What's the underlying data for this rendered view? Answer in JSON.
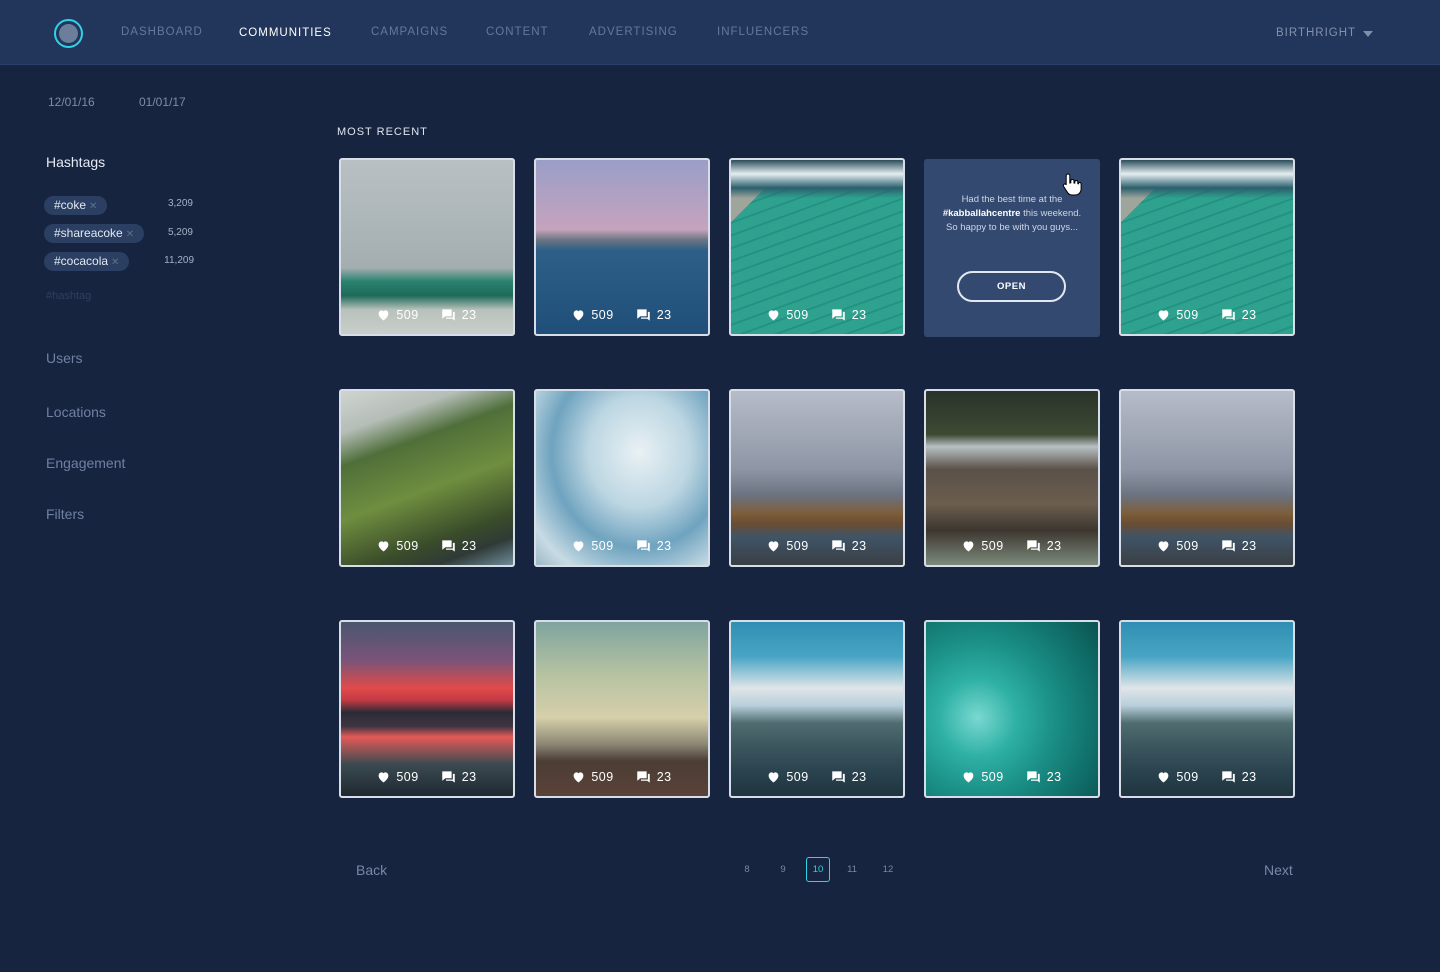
{
  "nav": {
    "items": [
      {
        "label": "DASHBOARD",
        "active": false
      },
      {
        "label": "COMMUNITIES",
        "active": true
      },
      {
        "label": "CAMPAIGNS",
        "active": false
      },
      {
        "label": "CONTENT",
        "active": false
      },
      {
        "label": "ADVERTISING",
        "active": false
      },
      {
        "label": "INFLUENCERS",
        "active": false
      }
    ],
    "account": "BIRTHRIGHT"
  },
  "sidebar": {
    "date_start": "12/01/16",
    "date_end": "01/01/17",
    "hashtags_title": "Hashtags",
    "hashtags": [
      {
        "tag": "#coke",
        "count": "3,209"
      },
      {
        "tag": "#shareacoke",
        "count": "5,209"
      },
      {
        "tag": "#cocacola",
        "count": "11,209"
      }
    ],
    "hashtag_placeholder": "#hashtag",
    "links": [
      "Users",
      "Locations",
      "Engagement",
      "Filters"
    ]
  },
  "main": {
    "section_title": "MOST RECENT",
    "stats": {
      "likes": "509",
      "comments": "23"
    },
    "tiles": [
      {
        "image": "surfer-wave"
      },
      {
        "image": "harbor-dusk"
      },
      {
        "image": "ocean-pool"
      },
      {
        "image": "overlay"
      },
      {
        "image": "ocean-pool"
      },
      {
        "image": "green-valley"
      },
      {
        "image": "iceberg"
      },
      {
        "image": "rocky-coast"
      },
      {
        "image": "waterfall"
      },
      {
        "image": "rocky-coast"
      },
      {
        "image": "red-sunset"
      },
      {
        "image": "beach-surfer"
      },
      {
        "image": "mountain-lake"
      },
      {
        "image": "swimmers"
      },
      {
        "image": "mountain-lake"
      }
    ],
    "overlay": {
      "text_before": "Had the best time at the ",
      "hashtag": "#kabballahcentre",
      "text_after": " this weekend. So happy to be with you guys...",
      "button": "OPEN"
    }
  },
  "pagination": {
    "back": "Back",
    "next": "Next",
    "pages": [
      "8",
      "9",
      "10",
      "11",
      "12"
    ],
    "current": "10"
  },
  "colors": {
    "accent": "#2fd2e6",
    "background": "#172440",
    "topbar": "#22355a"
  }
}
